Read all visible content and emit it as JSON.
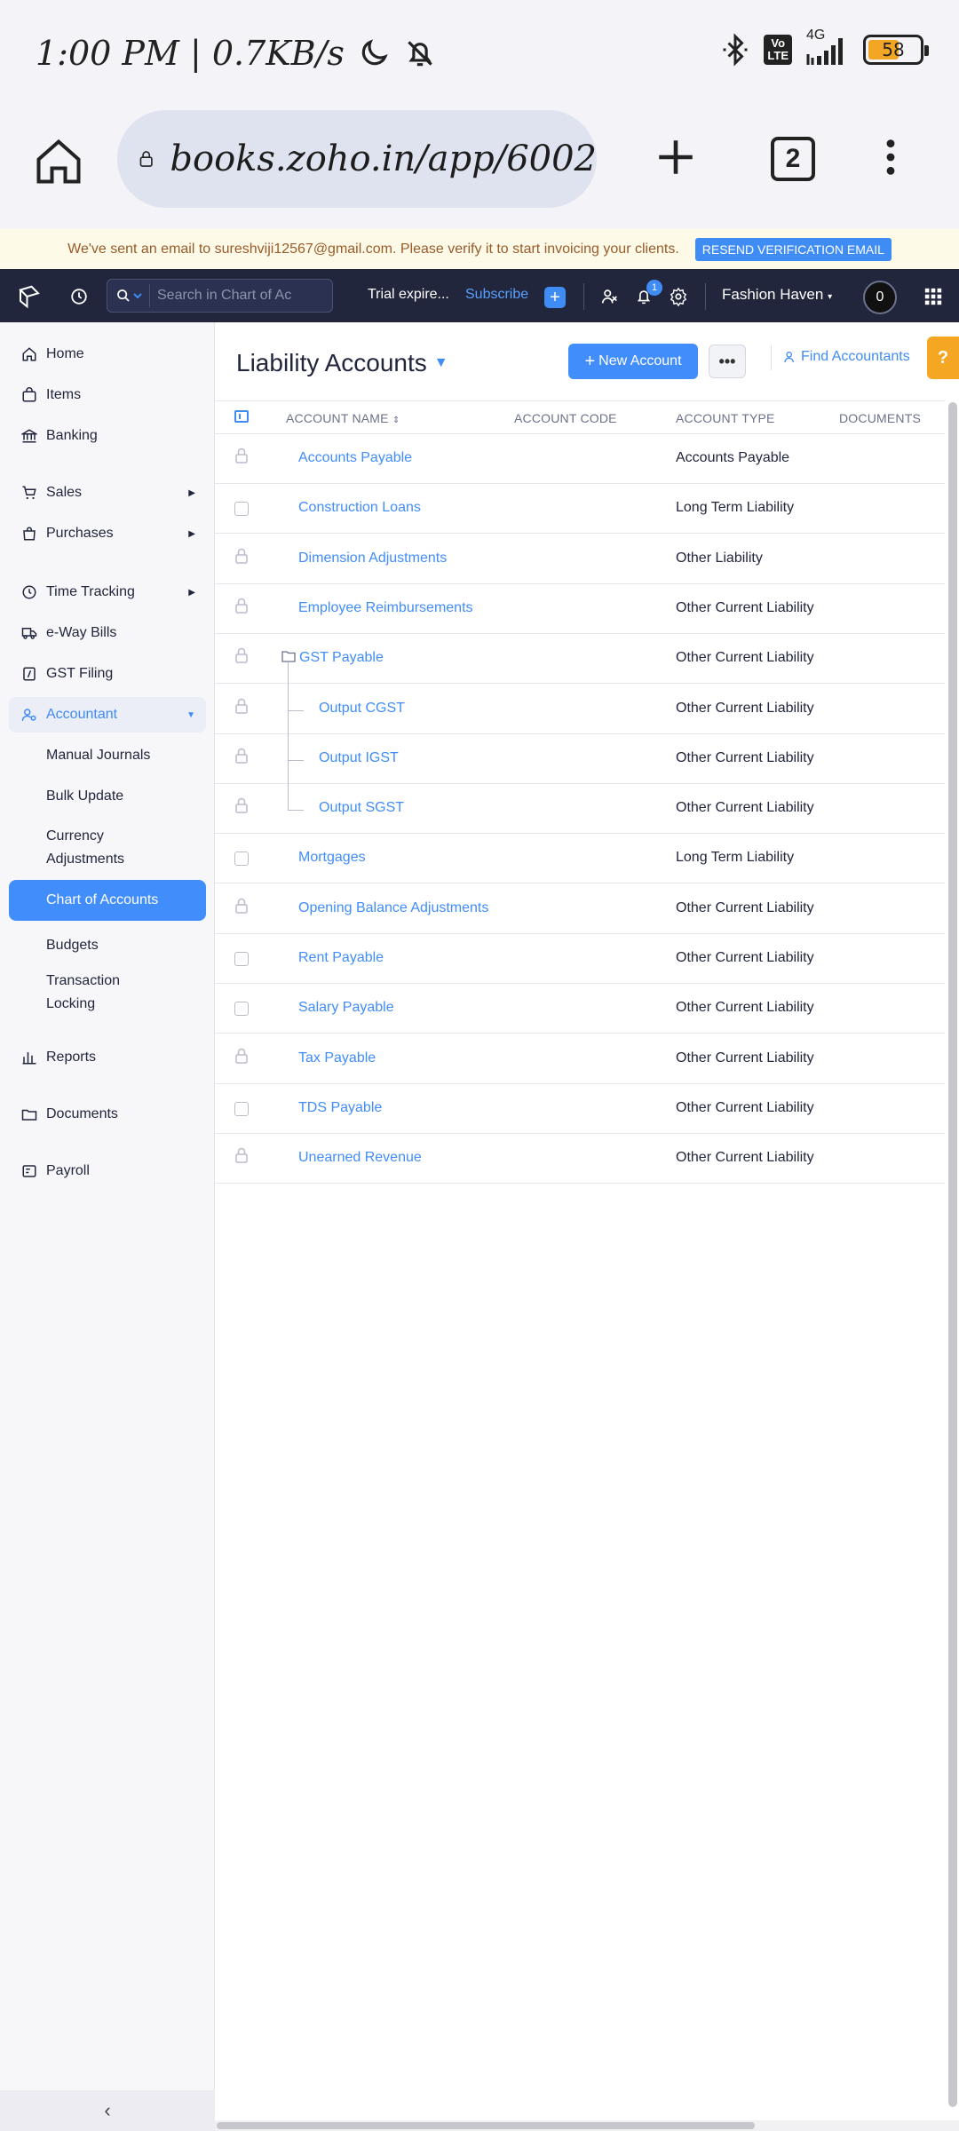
{
  "status_bar": {
    "time_speed": "1:00 PM | 0.7KB/s",
    "network": "4G",
    "volte": "Vo LTE",
    "battery": "58"
  },
  "browser": {
    "url": "books.zoho.in/app/6002",
    "tab_count": "2"
  },
  "banner": {
    "message": "We've sent an email to sureshviji12567@gmail.com. Please verify it to start invoicing your clients.",
    "button": "RESEND VERIFICATION EMAIL"
  },
  "topnav": {
    "search_placeholder": "Search in Chart of Ac",
    "trial": "Trial expire...",
    "subscribe": "Subscribe",
    "notification_count": "1",
    "org_name": "Fashion Haven",
    "avatar": "0"
  },
  "sidebar": {
    "items": [
      {
        "label": "Home",
        "icon": "home-icon"
      },
      {
        "label": "Items",
        "icon": "bag-icon"
      },
      {
        "label": "Banking",
        "icon": "bank-icon"
      },
      {
        "label": "Sales",
        "icon": "cart-icon"
      },
      {
        "label": "Purchases",
        "icon": "shopping-bag-icon"
      },
      {
        "label": "Time Tracking",
        "icon": "clock-icon"
      },
      {
        "label": "e-Way Bills",
        "icon": "truck-icon"
      },
      {
        "label": "GST Filing",
        "icon": "gst-icon"
      },
      {
        "label": "Accountant",
        "icon": "accountant-icon"
      }
    ],
    "sub_items": [
      "Manual Journals",
      "Bulk Update",
      "Currency Adjustments",
      "Chart of Accounts",
      "Budgets",
      "Transaction Locking"
    ],
    "bottom_items": [
      {
        "label": "Reports",
        "icon": "bar-chart-icon"
      },
      {
        "label": "Documents",
        "icon": "folder-icon"
      },
      {
        "label": "Payroll",
        "icon": "payroll-icon"
      }
    ]
  },
  "main": {
    "title": "Liability Accounts",
    "new_button": "New Account",
    "find_accountants": "Find Accountants",
    "help": "?",
    "columns": [
      "ACCOUNT NAME",
      "ACCOUNT CODE",
      "ACCOUNT TYPE",
      "DOCUMENTS"
    ],
    "rows": [
      {
        "name": "Accounts Payable",
        "type": "Accounts Payable",
        "locked": true,
        "level": 0
      },
      {
        "name": "Construction Loans",
        "type": "Long Term Liability",
        "locked": false,
        "level": 0
      },
      {
        "name": "Dimension Adjustments",
        "type": "Other Liability",
        "locked": true,
        "level": 0
      },
      {
        "name": "Employee Reimbursements",
        "type": "Other Current Liability",
        "locked": true,
        "level": 0
      },
      {
        "name": "GST Payable",
        "type": "Other Current Liability",
        "locked": true,
        "level": 0,
        "folder": true
      },
      {
        "name": "Output CGST",
        "type": "Other Current Liability",
        "locked": true,
        "level": 1
      },
      {
        "name": "Output IGST",
        "type": "Other Current Liability",
        "locked": true,
        "level": 1
      },
      {
        "name": "Output SGST",
        "type": "Other Current Liability",
        "locked": true,
        "level": 1,
        "last": true
      },
      {
        "name": "Mortgages",
        "type": "Long Term Liability",
        "locked": false,
        "level": 0
      },
      {
        "name": "Opening Balance Adjustments",
        "type": "Other Current Liability",
        "locked": true,
        "level": 0
      },
      {
        "name": "Rent Payable",
        "type": "Other Current Liability",
        "locked": false,
        "level": 0
      },
      {
        "name": "Salary Payable",
        "type": "Other Current Liability",
        "locked": false,
        "level": 0
      },
      {
        "name": "Tax Payable",
        "type": "Other Current Liability",
        "locked": true,
        "level": 0
      },
      {
        "name": "TDS Payable",
        "type": "Other Current Liability",
        "locked": false,
        "level": 0
      },
      {
        "name": "Unearned Revenue",
        "type": "Other Current Liability",
        "locked": true,
        "level": 0
      }
    ]
  },
  "colors": {
    "accent": "#408dfb",
    "topnav_bg": "#21263c",
    "help": "#f5a623"
  }
}
